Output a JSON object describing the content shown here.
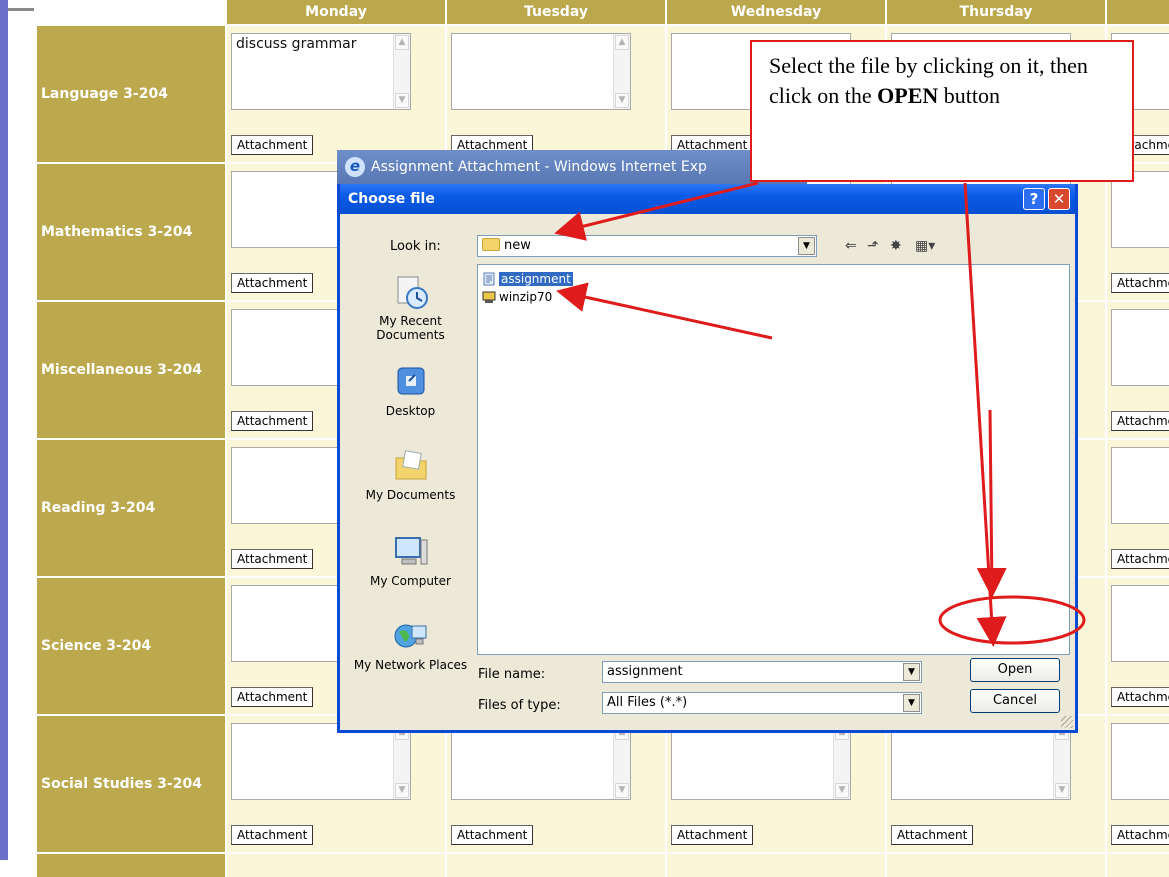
{
  "days": [
    "Monday",
    "Tuesday",
    "Wednesday",
    "Thursday",
    ""
  ],
  "subjects": [
    {
      "name": "Language 3-204",
      "monday_text": "discuss grammar"
    },
    {
      "name": "Mathematics 3-204",
      "monday_text": ""
    },
    {
      "name": "Miscellaneous 3-204",
      "monday_text": ""
    },
    {
      "name": "Reading 3-204",
      "monday_text": ""
    },
    {
      "name": "Science 3-204",
      "monday_text": ""
    },
    {
      "name": "Social Studies 3-204",
      "monday_text": ""
    }
  ],
  "attachment_label": "Attachment",
  "ie_window_title": "Assignment Attachment - Windows Internet Exp",
  "dialog": {
    "title": "Choose file",
    "help_label": "?",
    "close_label": "✕",
    "look_in_label": "Look in:",
    "look_in_value": "new",
    "places": [
      {
        "label": "My Recent Documents",
        "icon": "recent-documents-icon"
      },
      {
        "label": "Desktop",
        "icon": "desktop-icon"
      },
      {
        "label": "My Documents",
        "icon": "my-documents-icon"
      },
      {
        "label": "My Computer",
        "icon": "my-computer-icon"
      },
      {
        "label": "My Network Places",
        "icon": "network-places-icon"
      }
    ],
    "files": [
      {
        "name": "assignment",
        "selected": true,
        "icon": "text-file-icon"
      },
      {
        "name": "winzip70",
        "selected": false,
        "icon": "installer-icon"
      }
    ],
    "file_name_label": "File name:",
    "file_name_value": "assignment",
    "files_of_type_label": "Files of type:",
    "files_of_type_value": "All Files (*.*)",
    "open_label": "Open",
    "cancel_label": "Cancel"
  },
  "callout": {
    "line1": "Select the file by clicking on it, then click on the",
    "bold": "OPEN",
    "line2": "button"
  },
  "colors": {
    "subject_bg": "#bca94d",
    "cell_bg": "#fbf6d8",
    "dialog_title": "#0a5ae7",
    "annotation_red": "#e01b1b"
  }
}
